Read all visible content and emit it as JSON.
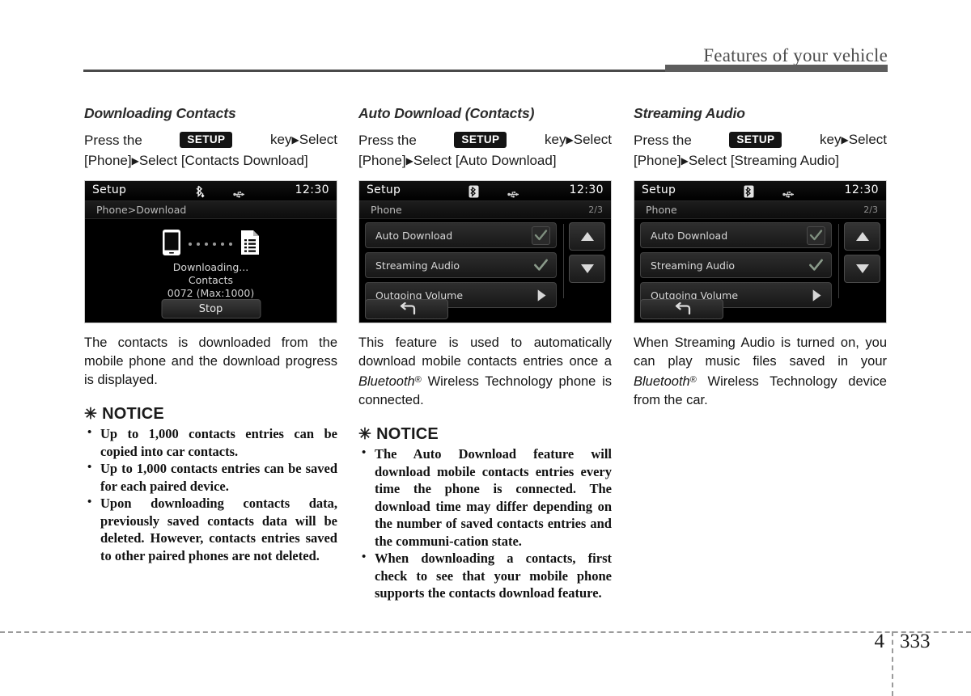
{
  "header": {
    "title": "Features of your vehicle"
  },
  "footer": {
    "chapter": "4",
    "page": "333"
  },
  "common": {
    "press_the": "Press    the",
    "setup_badge": "SETUP",
    "key_select": "key",
    "select": "Select",
    "phone_bracket": "[Phone]",
    "arrow": "▶",
    "notice_star": "✳",
    "notice_heading": "NOTICE"
  },
  "columns": [
    {
      "title": "Downloading Contacts",
      "path_line2_prefix": "[Phone]",
      "path_line2_tail": "Select [Contacts Download]",
      "screen": {
        "kind": "download",
        "status_title": "Setup",
        "clock": "12:30",
        "bt_icon": "bluetooth-download-icon",
        "usb_icon": "usb-icon",
        "breadcrumb": "Phone>Download",
        "page_indicator": "",
        "status_text": "Downloading...",
        "status_subject": "Contacts",
        "counter": "0072 (Max:1000)",
        "stop_label": "Stop"
      },
      "body": "The contacts is downloaded from the mobile phone and the download progress is displayed.",
      "notices": [
        "Up to 1,000 contacts entries can be copied into car contacts.",
        "Up to 1,000 contacts entries can be saved for each paired device.",
        "Upon downloading contacts data, previously saved contacts data will be deleted. However, contacts entries saved to other paired phones are not deleted."
      ]
    },
    {
      "title": "Auto Download (Contacts)",
      "path_line2_prefix": "[Phone]",
      "path_line2_tail": "Select [Auto Download]",
      "screen": {
        "kind": "list",
        "status_title": "Setup",
        "clock": "12:30",
        "bt_icon": "bluetooth-icon",
        "usb_icon": "usb-icon",
        "breadcrumb": "Phone",
        "page_indicator": "2/3",
        "rows": [
          {
            "label": "Auto Download",
            "control": "check"
          },
          {
            "label": "Streaming Audio",
            "control": "check"
          },
          {
            "label": "Outgoing Volume",
            "control": "arrow"
          }
        ],
        "scroll_up": "scroll-up-icon",
        "scroll_down": "scroll-down-icon",
        "back_icon": "back-arrow-icon"
      },
      "body_parts": {
        "a": "This feature is used to automatically download mobile contacts entries once a ",
        "bt": "Bluetooth",
        "reg": "®",
        "b": " Wireless Technology phone is connected."
      },
      "notices": [
        "The Auto Download feature will download mobile contacts entries every time the phone is connected. The download time may differ depending on the number of saved contacts entries and the communi-cation state.",
        "When downloading a contacts, first check to see that your mobile phone supports the contacts download feature."
      ]
    },
    {
      "title": "Streaming Audio",
      "path_line2_prefix": "[Phone]",
      "path_line2_tail": "Select [Streaming Audio]",
      "screen": {
        "kind": "list",
        "status_title": "Setup",
        "clock": "12:30",
        "bt_icon": "bluetooth-icon",
        "usb_icon": "usb-icon",
        "breadcrumb": "Phone",
        "page_indicator": "2/3",
        "rows": [
          {
            "label": "Auto Download",
            "control": "check"
          },
          {
            "label": "Streaming Audio",
            "control": "check"
          },
          {
            "label": "Outgoing Volume",
            "control": "arrow"
          }
        ],
        "scroll_up": "scroll-up-icon",
        "scroll_down": "scroll-down-icon",
        "back_icon": "back-arrow-icon"
      },
      "body_parts": {
        "a": "When Streaming Audio is turned on, you can play music files saved in your ",
        "bt": "Bluetooth",
        "reg": "®",
        "b": " Wireless Technology device from the car."
      },
      "notices": []
    }
  ],
  "colors": {
    "rule_thin": "#4a4a4a",
    "rule_thick": "#5d5d5d",
    "header_text": "#4d4d4d",
    "screen_bg": "#000000",
    "badge_bg": "#141414"
  }
}
